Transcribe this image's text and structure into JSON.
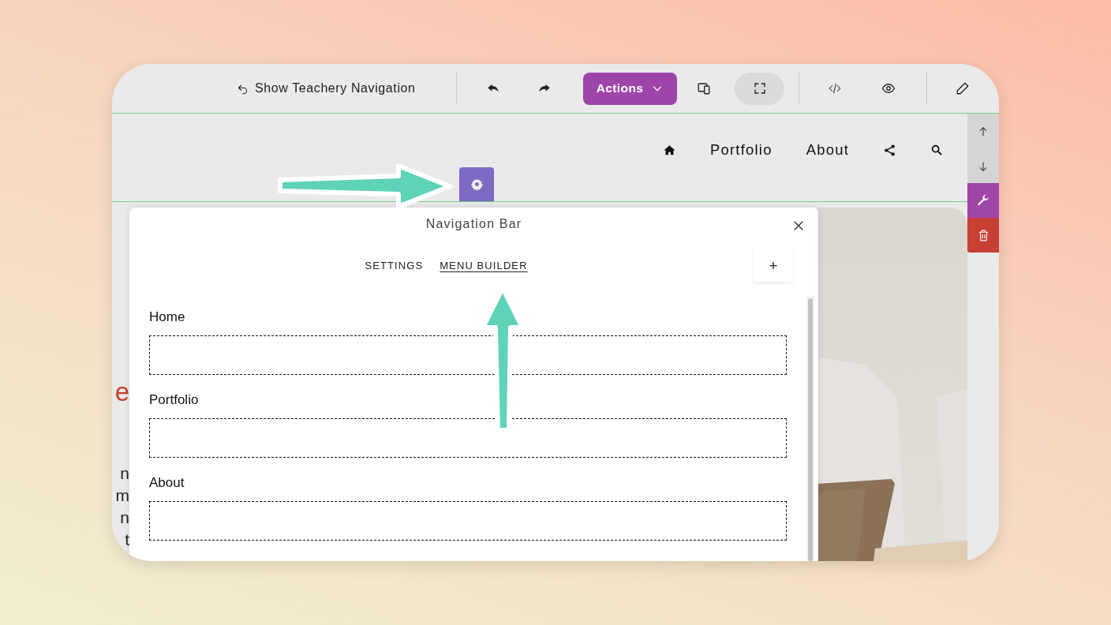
{
  "toolbar": {
    "back_link": "Show Teachery Navigation",
    "actions_button": "Actions"
  },
  "site_nav": {
    "links": [
      "Portfolio",
      "About"
    ]
  },
  "page_fragments": {
    "heading": [
      "e"
    ],
    "body": [
      "n",
      "m",
      "n",
      "t"
    ]
  },
  "panel": {
    "title": "Navigation Bar",
    "tabs": [
      {
        "label": "SETTINGS",
        "selected": false
      },
      {
        "label": "MENU BUILDER",
        "selected": true
      }
    ],
    "add_button": "+",
    "menu_items": [
      {
        "label": "Home"
      },
      {
        "label": "Portfolio"
      },
      {
        "label": "About"
      }
    ]
  }
}
